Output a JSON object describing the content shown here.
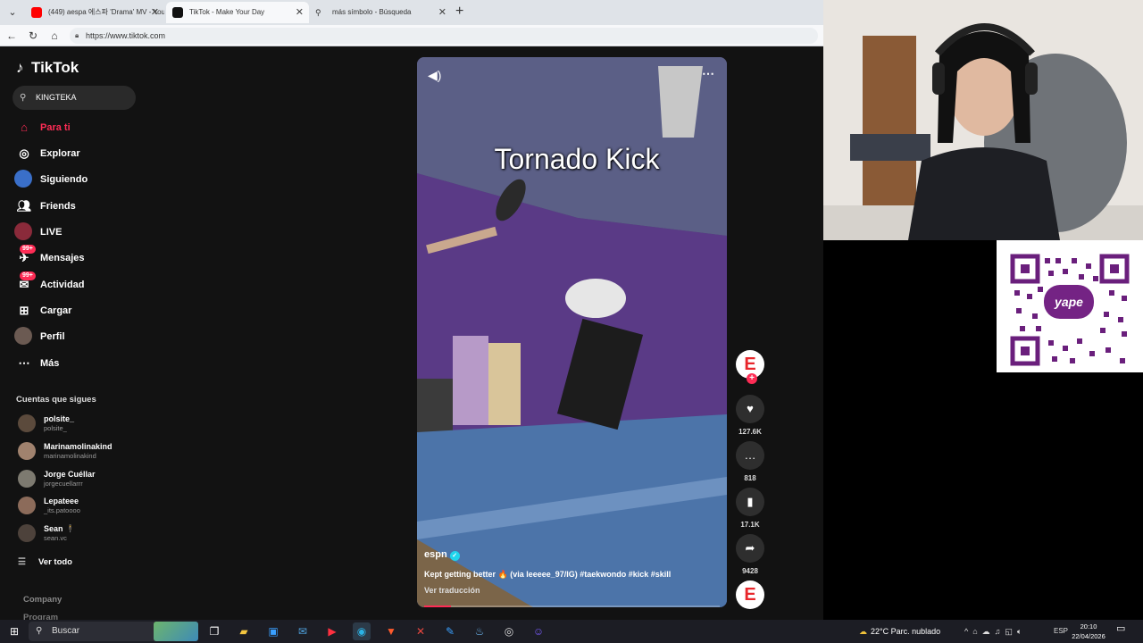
{
  "browser": {
    "tabs": [
      {
        "title": "(449) aespa 에스파 'Drama' MV - YouTube",
        "active": false
      },
      {
        "title": "TikTok - Make Your Day",
        "active": true
      },
      {
        "title": "más símbolo - Búsqueda",
        "active": false
      }
    ],
    "url": "https://www.tiktok.com"
  },
  "tiktok": {
    "brand": "TikTok",
    "search_value": "KINGTEKA",
    "nav": [
      {
        "label": "Para ti",
        "icon": "home-icon",
        "active": true
      },
      {
        "label": "Explorar",
        "icon": "compass-icon",
        "active": false
      },
      {
        "label": "Siguiendo",
        "icon": "following-icon",
        "active": false
      },
      {
        "label": "Friends",
        "icon": "friends-icon",
        "active": false
      },
      {
        "label": "LIVE",
        "icon": "live-icon",
        "active": false
      },
      {
        "label": "Mensajes",
        "icon": "messages-icon",
        "active": false,
        "badge": "99+"
      },
      {
        "label": "Actividad",
        "icon": "activity-icon",
        "active": false,
        "badge": "99+"
      },
      {
        "label": "Cargar",
        "icon": "upload-icon",
        "active": false
      },
      {
        "label": "Perfil",
        "icon": "profile-icon",
        "active": false
      },
      {
        "label": "Más",
        "icon": "more-icon",
        "active": false
      }
    ],
    "following_title": "Cuentas que sigues",
    "accounts": [
      {
        "name": "polsite_",
        "handle": "polsite_"
      },
      {
        "name": "Marinamolinakind",
        "handle": "marinamolinakind"
      },
      {
        "name": "Jorge Cuéllar",
        "handle": "jorgecuellarrr"
      },
      {
        "name": "Lepateee",
        "handle": "_its.patoooo"
      },
      {
        "name": "Sean 🕴",
        "handle": "sean.vc"
      }
    ],
    "see_all": "Ver todo",
    "footer": {
      "company": "Company",
      "program": "Program"
    },
    "video": {
      "overlay_title": "Tornado Kick",
      "author": "espn",
      "caption": "Kept getting better 🔥 (via leeeee_97/IG) #taekwondo #kick #skill",
      "translate": "Ver traducción",
      "progress": 0.09,
      "likes": "127.6K",
      "comments": "818",
      "saves": "17.1K",
      "shares": "9428"
    }
  },
  "overlay": {
    "yape_label": "yape"
  },
  "taskbar": {
    "search_placeholder": "Buscar",
    "weather": "22°C  Parc. nublado",
    "language": "ESP",
    "time": "20:10",
    "date": "22/04/2026"
  },
  "colors": {
    "accent": "#fe2c55",
    "sidebar_bg": "#121212",
    "espn_red": "#e8262b",
    "yape_purple": "#742384"
  }
}
